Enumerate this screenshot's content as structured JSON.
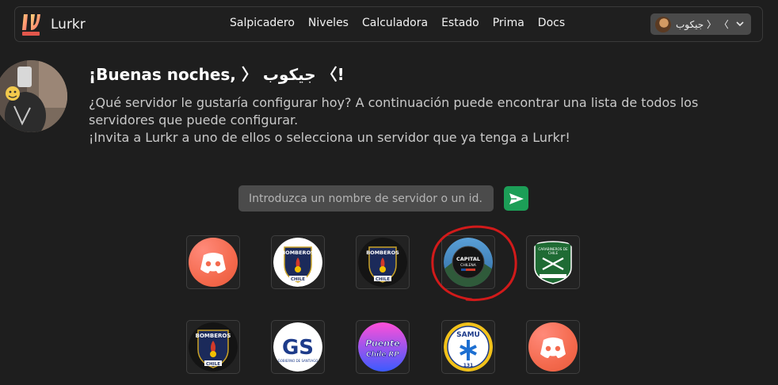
{
  "navbar": {
    "brand_name": "Lurkr",
    "links": [
      "Salpicadero",
      "Niveles",
      "Calculadora",
      "Estado",
      "Prima",
      "Docs"
    ],
    "user_name": "جيكوب 〉 〈"
  },
  "header": {
    "greeting": "¡Buenas noches, 〉 جيكوب 〈!",
    "line1": "¿Qué servidor le gustaría configurar hoy? A continuación puede encontrar una lista de todos los servidores que puede configurar.",
    "line2": "¡Invita a Lurkr a uno de ellos o selecciona un servidor que ya tenga a Lurkr!"
  },
  "search": {
    "placeholder": "Introduzca un nombre de servidor o un id..."
  },
  "servers": {
    "row1": [
      {
        "icon": "discord-default-icon"
      },
      {
        "icon": "bomberos-chile-icon",
        "text": "BOMBEROS",
        "sub": "CHILE"
      },
      {
        "icon": "bomberos-chile-dark-icon",
        "text": "BOMBEROS",
        "sub": "CHILE"
      },
      {
        "icon": "capital-chilena-icon",
        "text": "CAPITAL",
        "sub": "CHILENA"
      },
      {
        "icon": "carabineros-icon",
        "text": "CARABINEROS DE",
        "sub": "CHILE"
      }
    ],
    "row2": [
      {
        "icon": "bomberos-chile-icon",
        "text": "BOMBEROS",
        "sub": "CHILE"
      },
      {
        "icon": "gobierno-santiago-icon",
        "text": "GS",
        "sub": "GOBIERNO DE SANTIAGO"
      },
      {
        "icon": "puente-chile-rp-icon",
        "text": "Puente",
        "sub": "Chile RP"
      },
      {
        "icon": "samu-icon",
        "text": "SAMU",
        "sub": "131"
      },
      {
        "icon": "discord-default-icon"
      }
    ]
  },
  "colors": {
    "background": "#1e1e1e",
    "send_button": "#1c9e57",
    "annotation": "#d11a1a",
    "discord_default": "#f46a4e"
  }
}
